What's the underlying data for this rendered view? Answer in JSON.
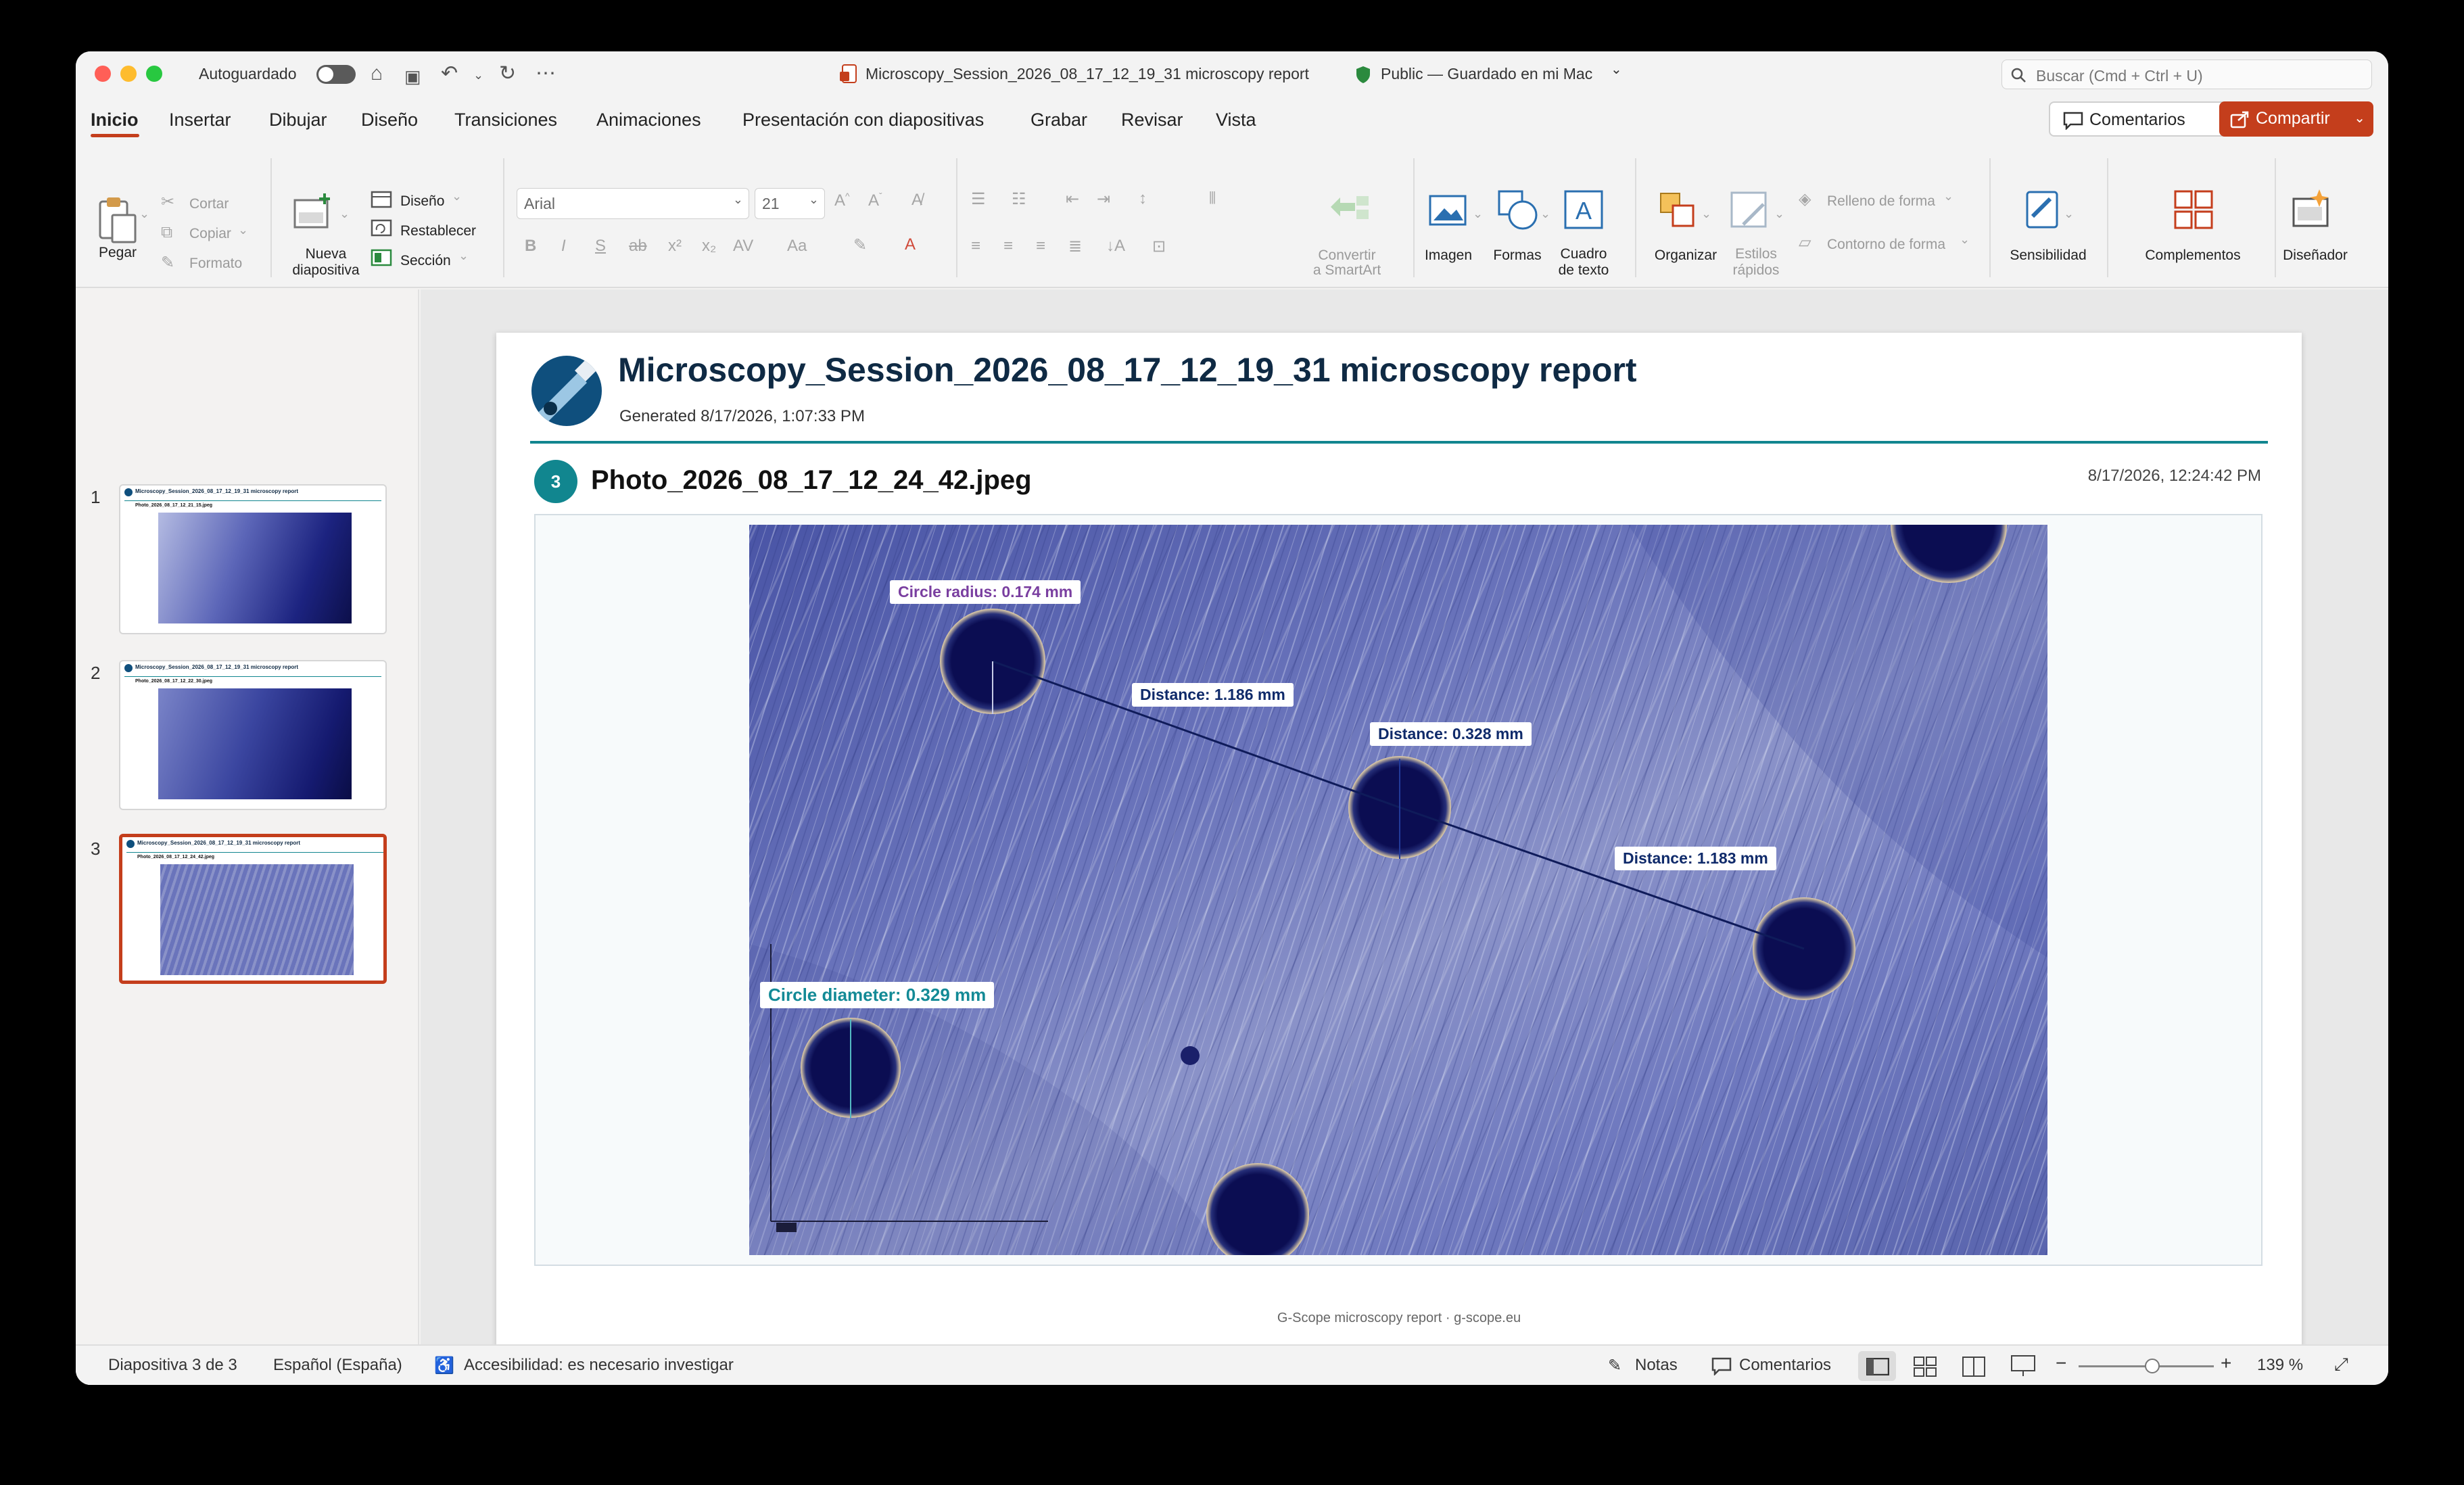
{
  "titlebar": {
    "autosave_label": "Autoguardado",
    "doc_title": "Microscopy_Session_2026_08_17_12_19_31 microscopy report",
    "status": "Public — Guardado en mi Mac",
    "search_placeholder": "Buscar (Cmd + Ctrl + U)"
  },
  "tabs": [
    "Inicio",
    "Insertar",
    "Dibujar",
    "Diseño",
    "Transiciones",
    "Animaciones",
    "Presentación con diapositivas",
    "Grabar",
    "Revisar",
    "Vista"
  ],
  "header_buttons": {
    "comments": "Comentarios",
    "share": "Compartir"
  },
  "ribbon": {
    "paste": "Pegar",
    "cut": "Cortar",
    "copy": "Copiar",
    "format": "Formato",
    "new_slide_line1": "Nueva",
    "new_slide_line2": "diapositiva",
    "layout": "Diseño",
    "reset": "Restablecer",
    "section": "Sección",
    "font_name": "Arial",
    "font_size": "21",
    "convert_line1": "Convertir",
    "convert_line2": "a SmartArt",
    "image": "Imagen",
    "shapes": "Formas",
    "textbox_line1": "Cuadro",
    "textbox_line2": "de texto",
    "arrange": "Organizar",
    "quick_styles_line1": "Estilos",
    "quick_styles_line2": "rápidos",
    "shape_fill": "Relleno de forma",
    "shape_outline": "Contorno de forma",
    "sensitivity": "Sensibilidad",
    "addins": "Complementos",
    "designer": "Diseñador"
  },
  "thumbnails": [
    {
      "number": "1",
      "title": "Microscopy_Session_2026_08_17_12_19_31 microscopy report",
      "photo": "Photo_2026_08_17_12_21_15.jpeg"
    },
    {
      "number": "2",
      "title": "Microscopy_Session_2026_08_17_12_19_31 microscopy report",
      "photo": "Photo_2026_08_17_12_22_30.jpeg"
    },
    {
      "number": "3",
      "title": "Microscopy_Session_2026_08_17_12_19_31 microscopy report",
      "photo": "Photo_2026_08_17_12_24_42.jpeg"
    }
  ],
  "slide": {
    "title": "Microscopy_Session_2026_08_17_12_19_31 microscopy report",
    "generated": "Generated 8/17/2026, 1:07:33 PM",
    "photo_number": "3",
    "photo_name": "Photo_2026_08_17_12_24_42.jpeg",
    "photo_timestamp": "8/17/2026, 12:24:42 PM",
    "footer": "G-Scope microscopy report · g-scope.eu",
    "measurements": {
      "radius": "Circle radius: 0.174 mm",
      "distance1": "Distance: 1.186 mm",
      "distance2": "Distance: 0.328 mm",
      "distance3": "Distance: 1.183 mm",
      "diameter": "Circle diameter: 0.329 mm"
    }
  },
  "status": {
    "slide_counter": "Diapositiva 3 de 3",
    "language": "Español (España)",
    "accessibility": "Accesibilidad: es necesario investigar",
    "notes": "Notas",
    "comments": "Comentarios",
    "zoom": "139 %"
  },
  "colors": {
    "accent": "#c43e1c",
    "teal": "#11868f",
    "title_navy": "#0f2a44",
    "radius_label": "#7a3fa0",
    "diameter_label": "#138a96"
  }
}
